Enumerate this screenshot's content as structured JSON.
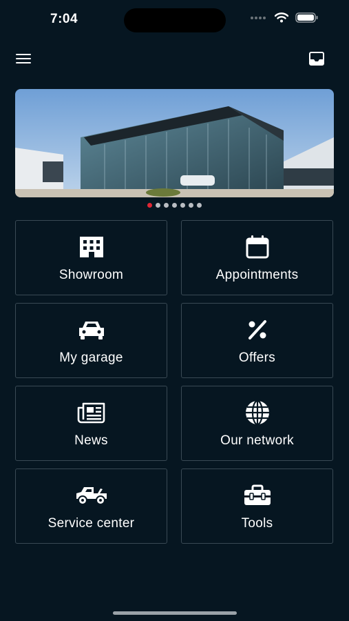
{
  "status_bar": {
    "time": "7:04"
  },
  "header": {
    "menu_icon": "hamburger-menu-icon",
    "inbox_icon": "inbox-icon"
  },
  "carousel": {
    "slide_count": 7,
    "active_index": 0,
    "active_color": "#e02634",
    "inactive_color": "#b9bdc2"
  },
  "menu": {
    "items": [
      {
        "label": "Showroom",
        "icon": "building-icon"
      },
      {
        "label": "Appointments",
        "icon": "calendar-icon"
      },
      {
        "label": "My garage",
        "icon": "car-icon"
      },
      {
        "label": "Offers",
        "icon": "percent-icon"
      },
      {
        "label": "News",
        "icon": "newspaper-icon"
      },
      {
        "label": "Our network",
        "icon": "globe-icon"
      },
      {
        "label": "Service center",
        "icon": "tow-truck-icon"
      },
      {
        "label": "Tools",
        "icon": "toolbox-icon"
      }
    ]
  },
  "colors": {
    "background": "#061621",
    "tile_border": "#3a4a55",
    "text": "#ffffff"
  }
}
